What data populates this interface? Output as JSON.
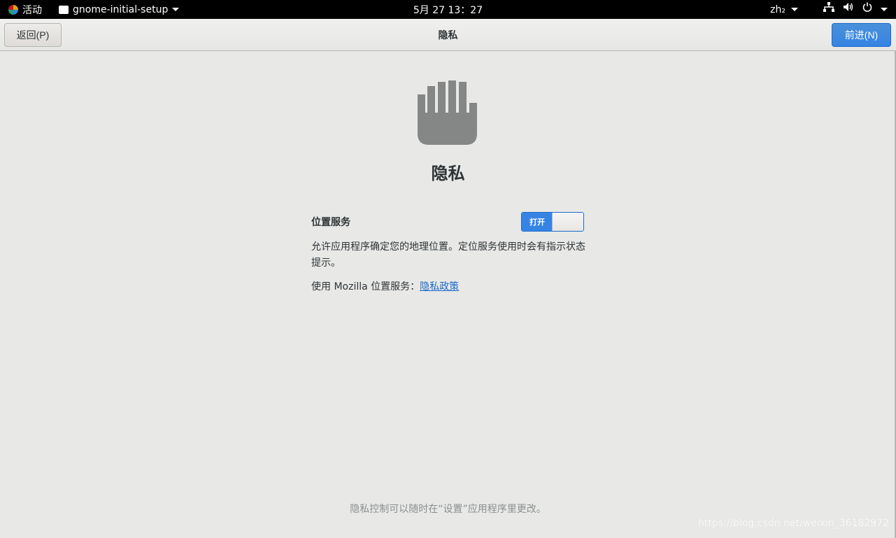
{
  "topbar": {
    "activities_label": "活动",
    "app_name": "gnome-initial-setup",
    "clock": "5月 27 13：27",
    "lang": "zh₂",
    "icons": [
      "network-icon",
      "volume-icon",
      "power-icon"
    ]
  },
  "header": {
    "back_label": "返回(P)",
    "title": "隐私",
    "next_label": "前进(N)"
  },
  "main": {
    "icon": "hand-icon",
    "heading": "隐私",
    "location_label": "位置服务",
    "switch_label": "打开",
    "description": "允许应用程序确定您的地理位置。定位服务使用时会有指示状态提示。",
    "mozilla_text": "使用 Mozilla 位置服务：",
    "policy_link": "隐私政策",
    "footer_note": "隐私控制可以随时在“设置”应用程序里更改。"
  },
  "watermark": "https://blog.csdn.net/weixin_36182972",
  "colors": {
    "accent": "#3584e4",
    "link": "#1b6acb",
    "icon_gray": "#858787"
  }
}
